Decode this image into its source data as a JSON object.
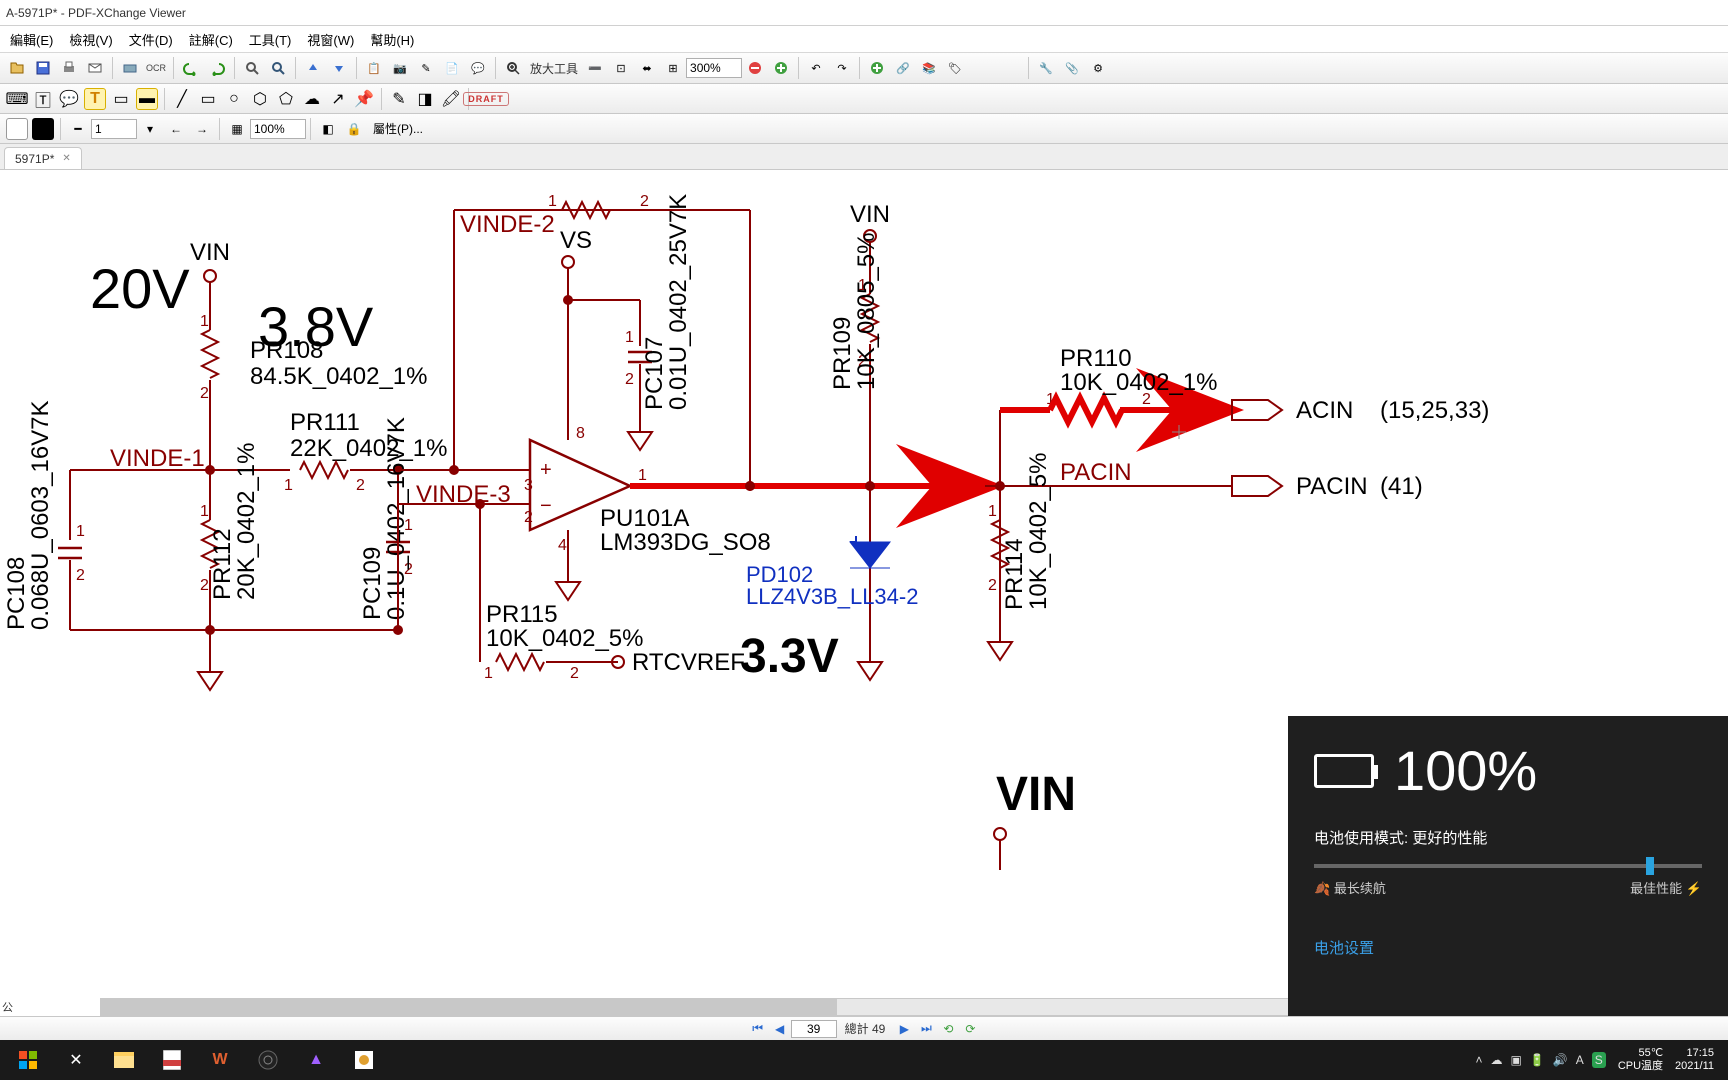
{
  "title": "A-5971P* - PDF-XChange Viewer",
  "menu": [
    "編輯(E)",
    "檢視(V)",
    "文件(D)",
    "註解(C)",
    "工具(T)",
    "視窗(W)",
    "幫助(H)"
  ],
  "toolbar": {
    "zoom_label": "放大工具",
    "zoom_value": "300%"
  },
  "propbar": {
    "line_width": "1",
    "opacity": "100%",
    "properties": "屬性(P)..."
  },
  "tab": "5971P*",
  "pager": {
    "page": "39",
    "total_label": "總計 49"
  },
  "coord": "公",
  "schematic": {
    "vin": "VIN",
    "v20": "20V",
    "v38": "3.8V",
    "vinde1": "VINDE-1",
    "vinde2": "VINDE-2",
    "vinde3": "VINDE-3",
    "vs": "VS",
    "pr108": {
      "ref": "PR108",
      "val": "84.5K_0402_1%"
    },
    "pr111": {
      "ref": "PR111",
      "val": "22K_0402_1%"
    },
    "pr112": {
      "ref": "PR112",
      "val": "20K_0402_1%"
    },
    "pr109": {
      "ref": "PR109",
      "val": "10K_0805_5%"
    },
    "pr110": {
      "ref": "PR110",
      "val": "10K_0402_1%"
    },
    "pr114": {
      "ref": "PR114",
      "val": "10K_0402_5%"
    },
    "pr115": {
      "ref": "PR115",
      "val": "10K_0402_5%"
    },
    "pc108": {
      "ref": "PC108",
      "val": "0.068U_0603_16V7K"
    },
    "pc109": {
      "ref": "PC109",
      "val": "0.1U_0402_16V7K"
    },
    "pc107": {
      "ref": "PC107",
      "val": "0.01U_0402_25V7K"
    },
    "pu101": {
      "ref": "PU101A",
      "val": "LM393DG_SO8"
    },
    "pd102": {
      "ref": "PD102",
      "val": "LLZ4V3B_LL34-2"
    },
    "rtcvref": "RTCVREF",
    "v33": "3.3V",
    "acin": "ACIN",
    "acin_pins": "(15,25,33)",
    "pacin": "PACIN",
    "pacin2": "PACIN",
    "pacin_pins": "(41)",
    "vin2": "VIN"
  },
  "battery": {
    "pct": "100%",
    "mode": "电池使用模式: 更好的性能",
    "left": "最长续航",
    "right": "最佳性能",
    "settings": "电池设置"
  },
  "tray": {
    "temp": "55℃",
    "templabel": "CPU温度",
    "time": "17:15",
    "date": "2021/11"
  }
}
